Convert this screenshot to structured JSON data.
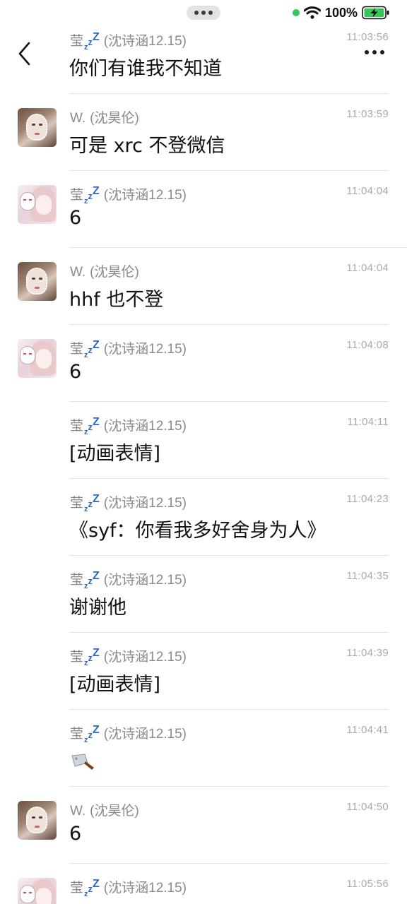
{
  "status_bar": {
    "battery": "100%"
  },
  "header": {
    "back_icon": "chevron-left-icon",
    "more_icon": "more-dots-icon"
  },
  "messages": [
    {
      "sender": "莹",
      "sender_note": "(沈诗涵12.15)",
      "has_zzz": true,
      "time": "11:03:56",
      "text": "你们有谁我不知道",
      "avatar": "none"
    },
    {
      "sender": "W.",
      "sender_note": "(沈昊伦)",
      "has_zzz": false,
      "time": "11:03:59",
      "text": "可是 xrc 不登微信",
      "avatar": "w"
    },
    {
      "sender": "莹",
      "sender_note": "(沈诗涵12.15)",
      "has_zzz": true,
      "time": "11:04:04",
      "text": "6",
      "avatar": "y"
    },
    {
      "sender": "W.",
      "sender_note": "(沈昊伦)",
      "has_zzz": false,
      "time": "11:04:04",
      "text": "hhf 也不登",
      "avatar": "w"
    },
    {
      "sender": "莹",
      "sender_note": "(沈诗涵12.15)",
      "has_zzz": true,
      "time": "11:04:08",
      "text": "6",
      "avatar": "y"
    },
    {
      "sender": "莹",
      "sender_note": "(沈诗涵12.15)",
      "has_zzz": true,
      "time": "11:04:11",
      "text": "[动画表情]",
      "avatar": "none"
    },
    {
      "sender": "莹",
      "sender_note": "(沈诗涵12.15)",
      "has_zzz": true,
      "time": "11:04:23",
      "text": "《syf：你看我多好舍身为人》",
      "avatar": "none"
    },
    {
      "sender": "莹",
      "sender_note": "(沈诗涵12.15)",
      "has_zzz": true,
      "time": "11:04:35",
      "text": "谢谢他",
      "avatar": "none"
    },
    {
      "sender": "莹",
      "sender_note": "(沈诗涵12.15)",
      "has_zzz": true,
      "time": "11:04:39",
      "text": "[动画表情]",
      "avatar": "none"
    },
    {
      "sender": "莹",
      "sender_note": "(沈诗涵12.15)",
      "has_zzz": true,
      "time": "11:04:41",
      "text": "",
      "emoji": "cleaver-icon",
      "avatar": "none"
    },
    {
      "sender": "W.",
      "sender_note": "(沈昊伦)",
      "has_zzz": false,
      "time": "11:04:50",
      "text": "6",
      "avatar": "w"
    },
    {
      "sender": "莹",
      "sender_note": "(沈诗涵12.15)",
      "has_zzz": true,
      "time": "11:05:56",
      "text": "",
      "avatar": "y"
    }
  ],
  "colors": {
    "sender": "#8a8a8a",
    "zzz": "#2f66c9",
    "time": "#a9a9a9",
    "battery": "#34c759",
    "separator": "#e4e4e4"
  }
}
